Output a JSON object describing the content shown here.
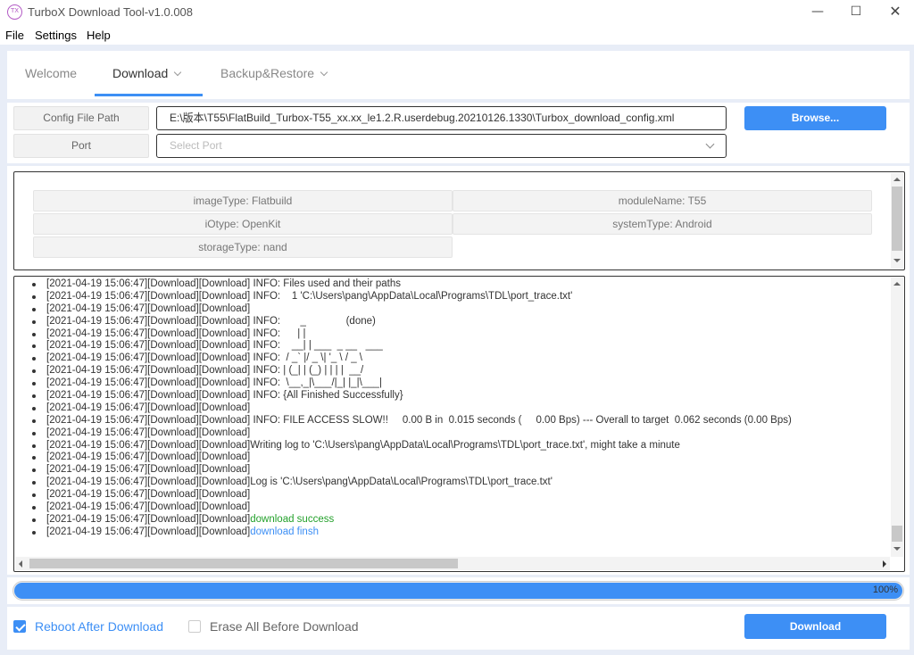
{
  "window": {
    "title": "TurboX Download Tool-v1.0.008",
    "icon": "turbox-icon",
    "icon_glyph": "TX",
    "minimize": "—",
    "maximize": "☐",
    "close": "✕"
  },
  "menu": [
    "File",
    "Settings",
    "Help"
  ],
  "tabs": [
    {
      "label": "Welcome",
      "active": false,
      "dropdown": false
    },
    {
      "label": "Download",
      "active": true,
      "dropdown": true
    },
    {
      "label": "Backup&Restore",
      "active": false,
      "dropdown": true
    }
  ],
  "config": {
    "config_label": "Config File Path",
    "config_value": "E:\\版本\\T55\\FlatBuild_Turbox-T55_xx.xx_le1.2.R.userdebug.20210126.1330\\Turbox_download_config.xml",
    "browse_label": "Browse...",
    "port_label": "Port",
    "port_placeholder": "Select Port"
  },
  "info": {
    "image_type": "imageType: Flatbuild",
    "module_name": "moduleName: T55",
    "io_type": "iOtype: OpenKit",
    "system_type": "systemType: Android",
    "storage_type": "storageType: nand"
  },
  "log": [
    {
      "text": "[2021-04-19 15:06:47][Download][Download] INFO: Files used and their paths",
      "highlight": ""
    },
    {
      "text": "[2021-04-19 15:06:47][Download][Download] INFO:    1 'C:\\Users\\pang\\AppData\\Local\\Programs\\TDL\\port_trace.txt'",
      "highlight": ""
    },
    {
      "text": "[2021-04-19 15:06:47][Download][Download]",
      "highlight": ""
    },
    {
      "text": "[2021-04-19 15:06:47][Download][Download] INFO:       _              (done)",
      "highlight": ""
    },
    {
      "text": "[2021-04-19 15:06:47][Download][Download] INFO:      | |",
      "highlight": ""
    },
    {
      "text": "[2021-04-19 15:06:47][Download][Download] INFO:    __| | ___  _ __   ___",
      "highlight": ""
    },
    {
      "text": "[2021-04-19 15:06:47][Download][Download] INFO:  / _` |/ _ \\| '_ \\ / _ \\",
      "highlight": ""
    },
    {
      "text": "[2021-04-19 15:06:47][Download][Download] INFO: | (_| | (_) | | | |  __/",
      "highlight": ""
    },
    {
      "text": "[2021-04-19 15:06:47][Download][Download] INFO:  \\__,_|\\___/|_| |_|\\___|",
      "highlight": ""
    },
    {
      "text": "[2021-04-19 15:06:47][Download][Download] INFO: {All Finished Successfully}",
      "highlight": ""
    },
    {
      "text": "[2021-04-19 15:06:47][Download][Download]",
      "highlight": ""
    },
    {
      "text": "[2021-04-19 15:06:47][Download][Download] INFO: FILE ACCESS SLOW!!     0.00 B in  0.015 seconds (     0.00 Bps) --- Overall to target  0.062 seconds (0.00 Bps)",
      "highlight": ""
    },
    {
      "text": "[2021-04-19 15:06:47][Download][Download]",
      "highlight": ""
    },
    {
      "text": "[2021-04-19 15:06:47][Download][Download]Writing log to 'C:\\Users\\pang\\AppData\\Local\\Programs\\TDL\\port_trace.txt', might take a minute",
      "highlight": ""
    },
    {
      "text": "[2021-04-19 15:06:47][Download][Download]",
      "highlight": ""
    },
    {
      "text": "[2021-04-19 15:06:47][Download][Download]",
      "highlight": ""
    },
    {
      "text": "[2021-04-19 15:06:47][Download][Download]Log is 'C:\\Users\\pang\\AppData\\Local\\Programs\\TDL\\port_trace.txt'",
      "highlight": ""
    },
    {
      "text": "[2021-04-19 15:06:47][Download][Download]",
      "highlight": ""
    },
    {
      "text": "[2021-04-19 15:06:47][Download][Download]",
      "highlight": ""
    },
    {
      "text": "[2021-04-19 15:06:47][Download][Download]",
      "highlight": "download success",
      "color": "green"
    },
    {
      "text": "[2021-04-19 15:06:47][Download][Download]",
      "highlight": "download finsh",
      "color": "blue"
    }
  ],
  "progress": {
    "value": 100,
    "label": "100%"
  },
  "options": {
    "reboot_label": "Reboot After Download",
    "reboot_checked": true,
    "erase_label": "Erase All Before Download",
    "erase_checked": false
  },
  "download_button": "Download",
  "colors": {
    "accent": "#3d8ff5",
    "success": "#24a12c",
    "background": "#e8edf7"
  }
}
